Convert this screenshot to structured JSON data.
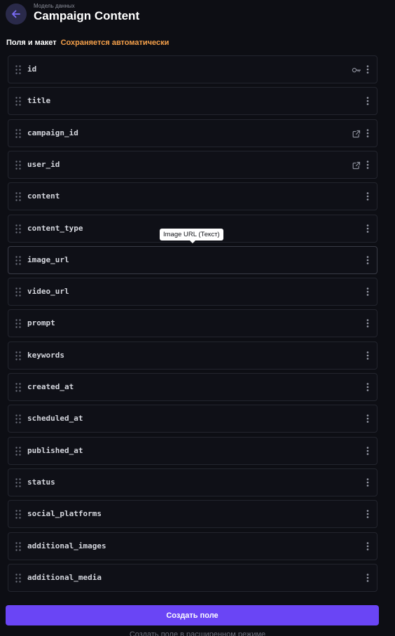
{
  "header": {
    "overline": "Модель данных",
    "title": "Campaign Content",
    "back_icon": "arrow-left-icon"
  },
  "section": {
    "label": "Поля и макет",
    "autosave": "Сохраняется автоматически"
  },
  "fields": [
    {
      "name": "id",
      "extra_icon": "key-icon"
    },
    {
      "name": "title",
      "extra_icon": ""
    },
    {
      "name": "campaign_id",
      "extra_icon": "external-link-icon"
    },
    {
      "name": "user_id",
      "extra_icon": "external-link-icon"
    },
    {
      "name": "content",
      "extra_icon": ""
    },
    {
      "name": "content_type",
      "extra_icon": ""
    },
    {
      "name": "image_url",
      "extra_icon": ""
    },
    {
      "name": "video_url",
      "extra_icon": ""
    },
    {
      "name": "prompt",
      "extra_icon": ""
    },
    {
      "name": "keywords",
      "extra_icon": ""
    },
    {
      "name": "created_at",
      "extra_icon": ""
    },
    {
      "name": "scheduled_at",
      "extra_icon": ""
    },
    {
      "name": "published_at",
      "extra_icon": ""
    },
    {
      "name": "status",
      "extra_icon": ""
    },
    {
      "name": "social_platforms",
      "extra_icon": ""
    },
    {
      "name": "additional_images",
      "extra_icon": ""
    },
    {
      "name": "additional_media",
      "extra_icon": ""
    }
  ],
  "tooltip": {
    "text": "Image URL (Текст)"
  },
  "actions": {
    "create_label": "Создать поле",
    "advanced_label": "Создать поле в расширенном режиме"
  },
  "colors": {
    "accent": "#6a45f5",
    "autosave": "#f5a04a",
    "background": "#0d0e14"
  }
}
